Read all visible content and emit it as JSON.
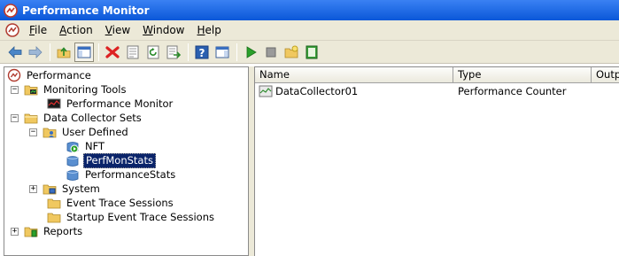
{
  "window": {
    "title": "Performance Monitor"
  },
  "menu": {
    "items": [
      {
        "acc": "F",
        "rest": "ile"
      },
      {
        "acc": "A",
        "rest": "ction"
      },
      {
        "acc": "V",
        "rest": "iew"
      },
      {
        "acc": "W",
        "rest": "indow"
      },
      {
        "acc": "H",
        "rest": "elp"
      }
    ]
  },
  "toolbar": {
    "icons": [
      "back-arrow-icon",
      "forward-arrow-icon",
      "up-folder-icon",
      "show-hide-console-tree-icon",
      "delete-icon",
      "properties-icon",
      "refresh-icon",
      "export-list-icon",
      "help-icon",
      "show-hide-action-pane-icon",
      "start-icon",
      "stop-icon",
      "new-data-collector-set-icon",
      "notebook-icon"
    ]
  },
  "tree": {
    "root": "Performance",
    "monitoring_tools": "Monitoring Tools",
    "performance_monitor": "Performance Monitor",
    "data_collector_sets": "Data Collector Sets",
    "user_defined": "User Defined",
    "nft": "NFT",
    "perfmonstats": "PerfMonStats",
    "performancestats": "PerformanceStats",
    "system": "System",
    "event_trace_sessions": "Event Trace Sessions",
    "startup_event_trace_sessions": "Startup Event Trace Sessions",
    "reports": "Reports",
    "expanded_marker": "−",
    "collapsed_marker": "+"
  },
  "list": {
    "columns": [
      "Name",
      "Type",
      "Outp"
    ],
    "rows": [
      {
        "name": "DataCollector01",
        "type": "Performance Counter"
      }
    ]
  }
}
